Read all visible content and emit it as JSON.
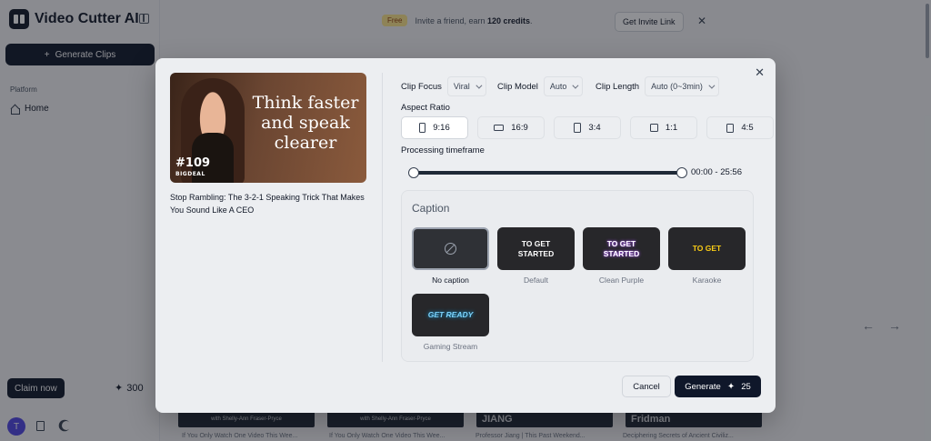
{
  "app": {
    "title": "Video Cutter AI",
    "generate_clips_label": "Generate Clips",
    "section_label": "Platform",
    "home_label": "Home",
    "claim_label": "Claim now",
    "credits": "300",
    "avatar_initial": "T"
  },
  "promo": {
    "badge": "Free",
    "text_prefix": "Invite a friend, earn",
    "text_bold": "120 credits",
    "text_suffix": ".",
    "invite_label": "Get Invite Link"
  },
  "background_videos": [
    {
      "thumb_text": "with Shelly-Ann Fraser-Pryce",
      "title": "If You Only Watch One Video This Wee..."
    },
    {
      "thumb_text": "with Shelly-Ann Fraser-Pryce",
      "title": "If You Only Watch One Video This Wee..."
    },
    {
      "thumb_text": "JIANG",
      "title": "Professor Jiang | This Past Weekend..."
    },
    {
      "thumb_text": "Fridman",
      "title": "Deciphering Secrets of Ancient Civiliz..."
    }
  ],
  "modal": {
    "video": {
      "thumbnail_text": "Think faster and speak clearer",
      "episode": "#109",
      "brand": "BIGDEAL",
      "title": "Stop Rambling: The 3-2-1 Speaking Trick That Makes You Sound Like A CEO"
    },
    "clip_focus": {
      "label": "Clip Focus",
      "value": "Viral"
    },
    "clip_model": {
      "label": "Clip Model",
      "value": "Auto"
    },
    "clip_length": {
      "label": "Clip Length",
      "value": "Auto (0~3min)"
    },
    "aspect_ratio": {
      "label": "Aspect Ratio",
      "options": [
        "9:16",
        "16:9",
        "3:4",
        "1:1",
        "4:5"
      ],
      "selected": "9:16"
    },
    "timeframe": {
      "label": "Processing timeframe",
      "value": "00:00 - 25:56",
      "start_fraction": 0.0,
      "end_fraction": 1.0
    },
    "caption": {
      "heading": "Caption",
      "options": [
        {
          "name": "No caption",
          "preview": "",
          "color": "#9ca3af",
          "selected": true
        },
        {
          "name": "Default",
          "preview": "TO GET STARTED",
          "color": "#ffffff",
          "selected": false
        },
        {
          "name": "Clean Purple",
          "preview": "TO GET STARTED",
          "color": "#ffffff",
          "selected": false
        },
        {
          "name": "Karaoke",
          "preview": "TO GET",
          "color": "#facc15",
          "selected": false
        },
        {
          "name": "Gaming Stream",
          "preview": "GET READY",
          "color": "#38bdf8",
          "selected": false
        }
      ]
    },
    "cancel_label": "Cancel",
    "generate_label": "Generate",
    "generate_cost": "25"
  }
}
